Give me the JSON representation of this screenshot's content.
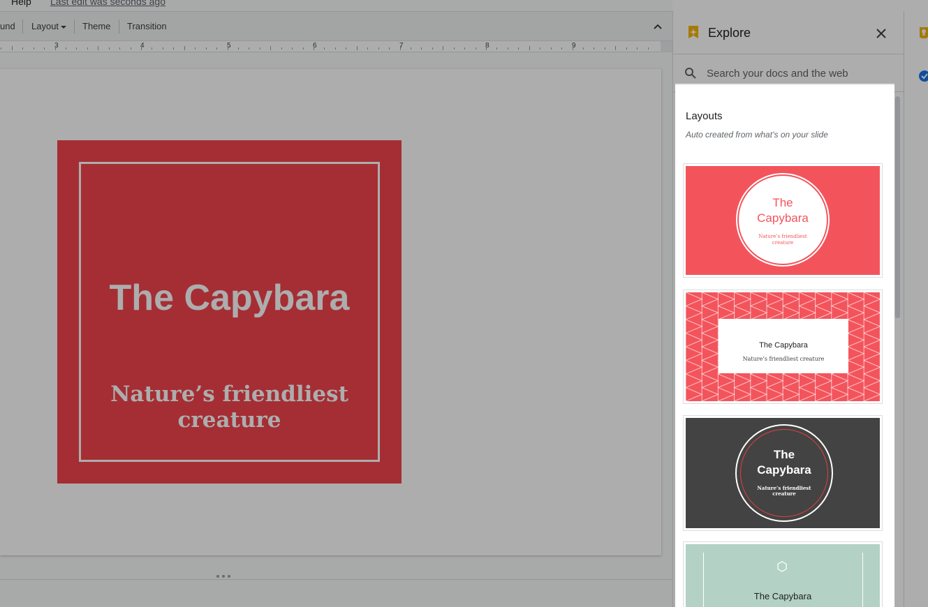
{
  "menubar": {
    "help_label": "Help",
    "last_edit": "Last edit was seconds ago"
  },
  "toolbar": {
    "background_label": "und",
    "layout_label": "Layout",
    "theme_label": "Theme",
    "transition_label": "Transition"
  },
  "ruler": {
    "numbers": [
      "3",
      "4",
      "5",
      "6",
      "7",
      "8",
      "9"
    ]
  },
  "slide": {
    "title": "The Capybara",
    "subtitle": "Nature’s friendliest creature",
    "bg_color": "#f3454d"
  },
  "explore": {
    "title": "Explore",
    "search_placeholder": "Search your docs and the web",
    "layouts_title": "Layouts",
    "layouts_subtitle": "Auto created from what’s on your slide",
    "thumbnails": [
      {
        "title_line1": "The",
        "title_line2": "Capybara",
        "subtitle_line1": "Nature’s friendliest",
        "subtitle_line2": "creature",
        "color": "#f3545c"
      },
      {
        "title": "The Capybara",
        "subtitle": "Nature’s friendliest creature",
        "color": "#f3545c"
      },
      {
        "title_line1": "The",
        "title_line2": "Capybara",
        "subtitle_line1": "Nature’s friendliest",
        "subtitle_line2": "creature",
        "color": "#434343"
      },
      {
        "title": "The Capybara",
        "color": "#b3d1c5"
      }
    ]
  },
  "icons": {
    "explore": "explore-sparkle-icon",
    "close": "close-icon",
    "search": "search-icon",
    "collapse": "chevron-up-icon",
    "keep": "keep-lightbulb-icon",
    "tasks": "tasks-check-icon"
  }
}
